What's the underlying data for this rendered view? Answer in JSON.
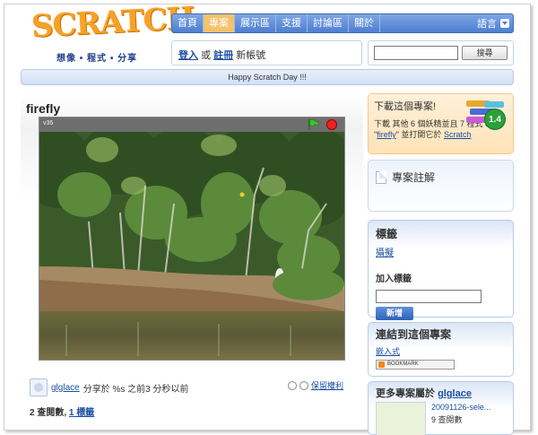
{
  "logo": {
    "word": "SCRATCH",
    "tagline": "想像 • 程式 • 分享"
  },
  "nav": {
    "items": [
      {
        "label": "首頁",
        "active": false
      },
      {
        "label": "專案",
        "active": true
      },
      {
        "label": "展示區",
        "active": false
      },
      {
        "label": "支援",
        "active": false
      },
      {
        "label": "討論區",
        "active": false
      },
      {
        "label": "關於",
        "active": false
      }
    ],
    "language_label": "語言"
  },
  "login": {
    "login_label": "登入",
    "or": "或",
    "register_label": "註冊",
    "new_account": "新帳號"
  },
  "search": {
    "button_label": "搜尋",
    "placeholder": ""
  },
  "banner": {
    "text": "Happy Scratch Day !!!"
  },
  "project": {
    "title": "firefly",
    "player_version": "v36",
    "author": "glglace",
    "shared_text": "分享於 %s 之前3 分秒以前",
    "rights_label": "保留權利",
    "views": "2 查閱數",
    "tag_count": "1 標籤"
  },
  "download": {
    "title": "下載這個專案!",
    "text_prefix": "下載 其他 6 個妖精並且 7 程式 of \"",
    "project_link": "firefly",
    "text_suffix": "\" 並打開它於",
    "scratch_link": "Scratch",
    "version": "1.4"
  },
  "notes": {
    "title": "專案註解"
  },
  "tags": {
    "title": "標籤",
    "tag": "攝擬",
    "add_label": "加入標籤",
    "add_button": "新增"
  },
  "link": {
    "title": "連結到這個專案",
    "embed": "嵌入式",
    "bookmark": "BOOKMARK"
  },
  "more": {
    "title_prefix": "更多專案屬於",
    "author": "glglace",
    "project_name": "20091126-sele...",
    "views": "9 查閱數"
  },
  "colors": {
    "accent_blue": "#4d7ed1",
    "active_tab": "#f3c26b",
    "logo_orange": "#f7a128",
    "link": "#1a4fa0"
  }
}
